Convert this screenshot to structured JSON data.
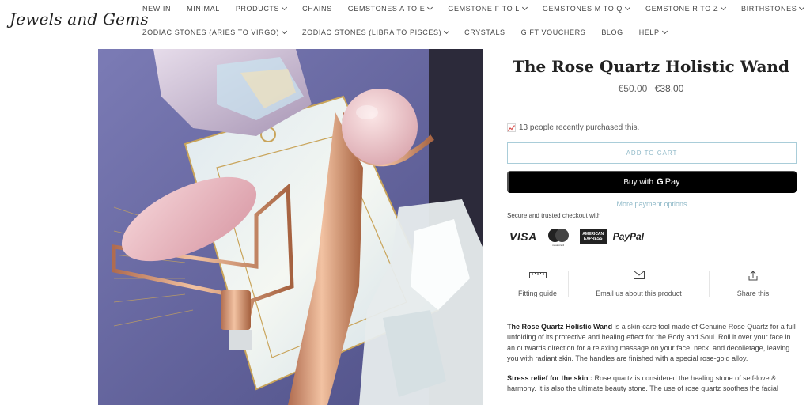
{
  "brand": {
    "logo_text": "Jewels and Gems"
  },
  "nav": {
    "row1": [
      {
        "label": "NEW IN",
        "dropdown": false
      },
      {
        "label": "MINIMAL",
        "dropdown": false
      },
      {
        "label": "PRODUCTS",
        "dropdown": true
      },
      {
        "label": "CHAINS",
        "dropdown": false
      },
      {
        "label": "GEMSTONES A TO E",
        "dropdown": true
      },
      {
        "label": "GEMSTONE F TO L",
        "dropdown": true
      },
      {
        "label": "GEMSTONES M TO Q",
        "dropdown": true
      },
      {
        "label": "GEMSTONE R TO Z",
        "dropdown": true
      },
      {
        "label": "BIRTHSTONES",
        "dropdown": true
      }
    ],
    "row2": [
      {
        "label": "ZODIAC STONES (ARIES TO VIRGO)",
        "dropdown": true
      },
      {
        "label": "ZODIAC STONES (LIBRA TO PISCES)",
        "dropdown": true
      },
      {
        "label": "CRYSTALS",
        "dropdown": false
      },
      {
        "label": "GIFT VOUCHERS",
        "dropdown": false
      },
      {
        "label": "BLOG",
        "dropdown": false
      },
      {
        "label": "HELP",
        "dropdown": true
      }
    ]
  },
  "product": {
    "title": "The Rose Quartz Holistic Wand",
    "old_price": "€50.00",
    "price": "€38.00",
    "recent_purchases": "13 people recently purchased this.",
    "add_to_cart": "ADD TO CART",
    "buy_with": "Buy with",
    "gpay_g": "G",
    "gpay_pay": "Pay",
    "more_payment": "More payment options",
    "secure_text": "Secure and trusted checkout with"
  },
  "payment_logos": {
    "visa": "VISA",
    "mastercard_text": "mastercard",
    "amex_line1": "AMERICAN",
    "amex_line2": "EXPRESS",
    "paypal": "PayPal"
  },
  "features": {
    "fitting_guide": "Fitting guide",
    "email": "Email us about this product",
    "share": "Share this"
  },
  "description": {
    "p1_bold": "The Rose Quartz Holistic Wand",
    "p1_text": " is a skin-care tool made of Genuine Rose Quartz for a full unfolding of its protective and healing effect for the Body and Soul. Roll it over your face in an outwards direction for a relaxing massage on your face, neck, and decolletage, leaving you with radiant skin. The handles are finished with a special rose-gold alloy.",
    "p2_bold": "Stress relief for the skin :",
    "p2_text": " Rose quartz is considered the healing stone of self-love & harmony. It is also the ultimate beauty stone. The use of rose quartz soothes the facial"
  },
  "colors": {
    "accent": "#8fb9c8",
    "button_dark": "#000000",
    "rose_gold": "#d99a78",
    "rose_quartz": "#f0c8cc"
  }
}
